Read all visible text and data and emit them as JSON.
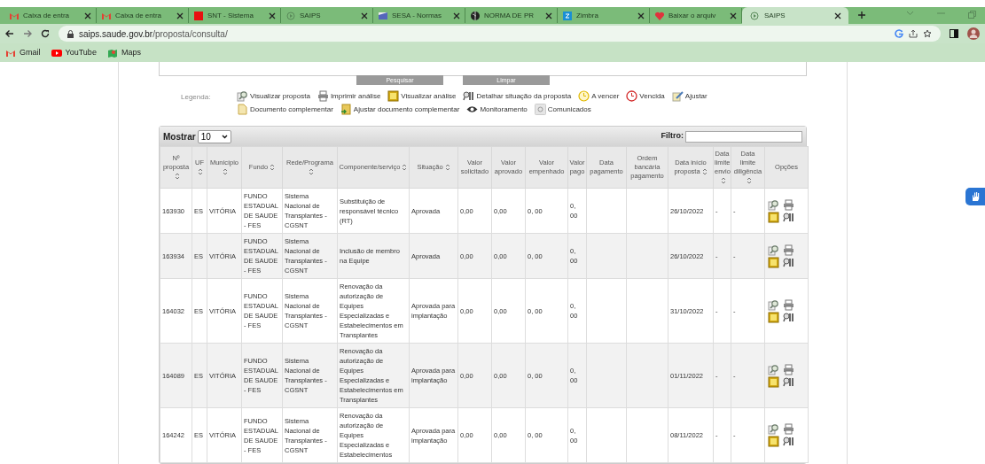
{
  "browser": {
    "tabs": [
      {
        "title": "Caixa de entra",
        "kind": "mail",
        "selected": false
      },
      {
        "title": "Caixa de entra",
        "kind": "mail",
        "selected": false
      },
      {
        "title": "SNT - Sistema",
        "kind": "square",
        "selected": false
      },
      {
        "title": "SAIPS",
        "kind": "loader",
        "selected": false
      },
      {
        "title": "SESA - Normas",
        "kind": "flag",
        "selected": false
      },
      {
        "title": "NORMA DE PR",
        "kind": "globe",
        "selected": false
      },
      {
        "title": "Zimbra",
        "kind": "zimbra",
        "selected": false
      },
      {
        "title": "Baixar o arquiv",
        "kind": "heart",
        "selected": false
      },
      {
        "title": "SAIPS",
        "kind": "loader",
        "selected": true
      }
    ],
    "url": {
      "host": "saips.saude.gov.br",
      "path": "/proposta/consulta/"
    },
    "bookmarks": [
      {
        "label": "Gmail",
        "kind": "mail"
      },
      {
        "label": "YouTube",
        "kind": "play"
      },
      {
        "label": "Maps",
        "kind": "map"
      }
    ]
  },
  "search_buttons": [
    "Pesquisar",
    "Limpar"
  ],
  "legend": {
    "label": "Legenda:",
    "lines": [
      [
        {
          "label": "Visualizar proposta",
          "kind": "view"
        },
        {
          "label": "Imprimir análise",
          "kind": "print"
        },
        {
          "label": "Visualizar análise",
          "kind": "analysis"
        },
        {
          "label": "Detalhar situação da proposta",
          "kind": "detail"
        },
        {
          "label": "A vencer",
          "kind": "due"
        },
        {
          "label": "Vencida",
          "kind": "late"
        },
        {
          "label": "Ajustar",
          "kind": "edit"
        }
      ],
      [
        {
          "label": "Documento complementar",
          "kind": "doc"
        },
        {
          "label": "Ajustar documento complementar",
          "kind": "docedit"
        },
        {
          "label": "Monitoramento",
          "kind": "eye"
        },
        {
          "label": "Comunicados",
          "kind": "notice"
        }
      ]
    ]
  },
  "table": {
    "show_label": "Mostrar",
    "page_size": "10",
    "filter_label": "Filtro:",
    "columns": [
      {
        "label": "Nº proposta",
        "sortable": true
      },
      {
        "label": "UF",
        "sortable": true
      },
      {
        "label": "Município",
        "sortable": true
      },
      {
        "label": "Fundo",
        "sortable": true
      },
      {
        "label": "Rede/Programa",
        "sortable": true
      },
      {
        "label": "Componente/serviço",
        "sortable": true
      },
      {
        "label": "Situação",
        "sortable": true
      },
      {
        "label": "Valor solicitado",
        "sortable": false
      },
      {
        "label": "Valor aprovado",
        "sortable": false
      },
      {
        "label": "Valor empenhado",
        "sortable": false
      },
      {
        "label": "Valor pago",
        "sortable": false
      },
      {
        "label": "Data pagamento",
        "sortable": false
      },
      {
        "label": "Ordem bancária pagamento",
        "sortable": false
      },
      {
        "label": "Data início proposta",
        "sortable": true
      },
      {
        "label": "Data limite envio",
        "sortable": true
      },
      {
        "label": "Data limite diligência",
        "sortable": true
      },
      {
        "label": "Opções",
        "sortable": false
      }
    ],
    "rows": [
      {
        "cells": [
          "163930",
          "ES",
          "VITÓRIA",
          "FUNDO ESTADUAL DE SAUDE - FES",
          "Sistema Nacional de Transplantes - CGSNT",
          "Substituição de responsável técnico (RT)",
          "Aprovada",
          "0,00",
          "0,00",
          "0, 00",
          "0, 00",
          "",
          "",
          "26/10/2022",
          "-",
          "-"
        ],
        "options": [
          {
            "kind": "view"
          },
          {
            "kind": "print"
          },
          {
            "kind": "analysis"
          },
          {
            "kind": "detail"
          }
        ]
      },
      {
        "cells": [
          "163934",
          "ES",
          "VITÓRIA",
          "FUNDO ESTADUAL DE SAUDE - FES",
          "Sistema Nacional de Transplantes - CGSNT",
          "Inclusão de membro na Equipe",
          "Aprovada",
          "0,00",
          "0,00",
          "0, 00",
          "0, 00",
          "",
          "",
          "26/10/2022",
          "-",
          "-"
        ],
        "options": [
          {
            "kind": "view"
          },
          {
            "kind": "print"
          },
          {
            "kind": "analysis"
          },
          {
            "kind": "detail"
          }
        ]
      },
      {
        "cells": [
          "164032",
          "ES",
          "VITÓRIA",
          "FUNDO ESTADUAL DE SAUDE - FES",
          "Sistema Nacional de Transplantes - CGSNT",
          "Renovação da autorização de Equipes Especializadas e Estabelecimentos em Transplantes",
          "Aprovada para implantação",
          "0,00",
          "0,00",
          "0, 00",
          "0, 00",
          "",
          "",
          "31/10/2022",
          "-",
          "-"
        ],
        "options": [
          {
            "kind": "view"
          },
          {
            "kind": "print"
          },
          {
            "kind": "analysis"
          },
          {
            "kind": "detail"
          }
        ]
      },
      {
        "cells": [
          "164089",
          "ES",
          "VITÓRIA",
          "FUNDO ESTADUAL DE SAUDE - FES",
          "Sistema Nacional de Transplantes - CGSNT",
          "Renovação da autorização de Equipes Especializadas e Estabelecimentos em Transplantes",
          "Aprovada para implantação",
          "0,00",
          "0,00",
          "0, 00",
          "0, 00",
          "",
          "",
          "01/11/2022",
          "-",
          "-"
        ],
        "options": [
          {
            "kind": "view"
          },
          {
            "kind": "print"
          },
          {
            "kind": "analysis"
          },
          {
            "kind": "detail"
          }
        ]
      },
      {
        "cells": [
          "164242",
          "ES",
          "VITÓRIA",
          "FUNDO ESTADUAL DE SAUDE - FES",
          "Sistema Nacional de Transplantes - CGSNT",
          "Renovação da autorização de Equipes Especializadas e Estabelecimentos",
          "Aprovada para implantação",
          "0,00",
          "0,00",
          "0, 00",
          "0, 00",
          "",
          "",
          "08/11/2022",
          "-",
          "-"
        ],
        "options": [
          {
            "kind": "view"
          },
          {
            "kind": "print"
          },
          {
            "kind": "analysis"
          },
          {
            "kind": "detail"
          }
        ]
      }
    ]
  }
}
